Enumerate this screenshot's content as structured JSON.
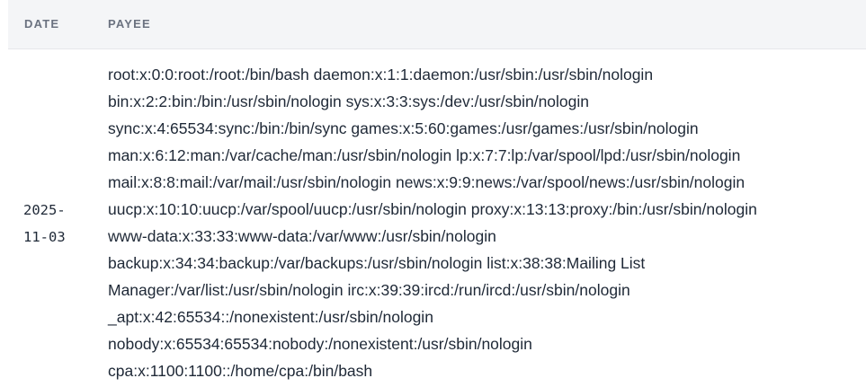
{
  "table": {
    "headers": {
      "date": "DATE",
      "payee": "PAYEE"
    },
    "rows": [
      {
        "date": "2025-\n11-03",
        "payee_lines": [
          "root:x:0:0:root:/root:/bin/bash daemon:x:1:1:daemon:/usr/sbin:/usr/sbin/nologin",
          "bin:x:2:2:bin:/bin:/usr/sbin/nologin sys:x:3:3:sys:/dev:/usr/sbin/nologin",
          "sync:x:4:65534:sync:/bin:/bin/sync games:x:5:60:games:/usr/games:/usr/sbin/nologin",
          "man:x:6:12:man:/var/cache/man:/usr/sbin/nologin lp:x:7:7:lp:/var/spool/lpd:/usr/sbin/nologin",
          "mail:x:8:8:mail:/var/mail:/usr/sbin/nologin news:x:9:9:news:/var/spool/news:/usr/sbin/nologin",
          "uucp:x:10:10:uucp:/var/spool/uucp:/usr/sbin/nologin proxy:x:13:13:proxy:/bin:/usr/sbin/nologin",
          "www-data:x:33:33:www-data:/var/www:/usr/sbin/nologin",
          "backup:x:34:34:backup:/var/backups:/usr/sbin/nologin list:x:38:38:Mailing List",
          "Manager:/var/list:/usr/sbin/nologin irc:x:39:39:ircd:/run/ircd:/usr/sbin/nologin",
          "_apt:x:42:65534::/nonexistent:/usr/sbin/nologin",
          "nobody:x:65534:65534:nobody:/nonexistent:/usr/sbin/nologin",
          "cpa:x:1100:1100::/home/cpa:/bin/bash"
        ]
      }
    ]
  }
}
